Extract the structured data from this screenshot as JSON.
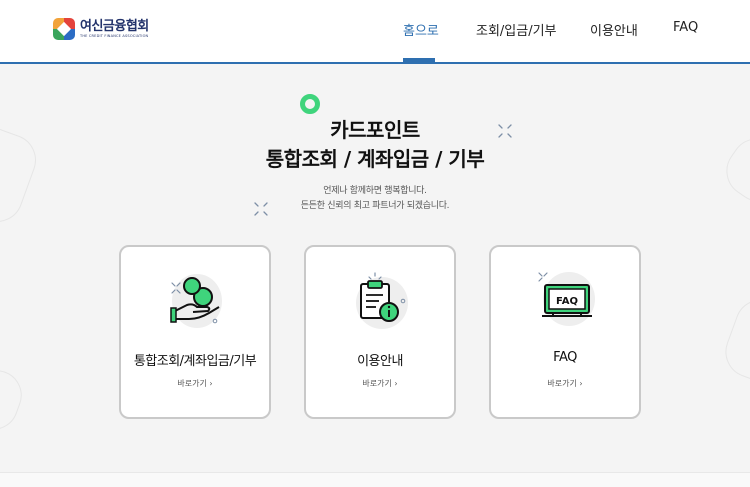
{
  "header": {
    "logo": {
      "name": "여신금융협회",
      "subtitle": "THE CREDIT FINANCE ASSOCIATION"
    },
    "nav": [
      {
        "label": "홈으로",
        "active": true
      },
      {
        "label": "조회/입금/기부",
        "active": false
      },
      {
        "label": "이용안내",
        "active": false
      },
      {
        "label": "FAQ",
        "active": false
      }
    ]
  },
  "hero": {
    "title_line1": "카드포인트",
    "title_line2": "통합조회 / 계좌입금 / 기부",
    "subtitle_line1": "언제나 함께하면 행복합니다.",
    "subtitle_line2": "든든한 신뢰의 최고 파트너가 되겠습니다."
  },
  "cards": [
    {
      "title": "통합조회/계좌입금/기부",
      "link": "바로가기 ›",
      "icon": "coin-hand-icon"
    },
    {
      "title": "이용안내",
      "link": "바로가기 ›",
      "icon": "clipboard-info-icon"
    },
    {
      "title": "FAQ",
      "link": "바로가기 ›",
      "icon": "faq-board-icon"
    }
  ],
  "colors": {
    "accent": "#2e6fb0",
    "green": "#3fd47c",
    "text": "#111111"
  }
}
